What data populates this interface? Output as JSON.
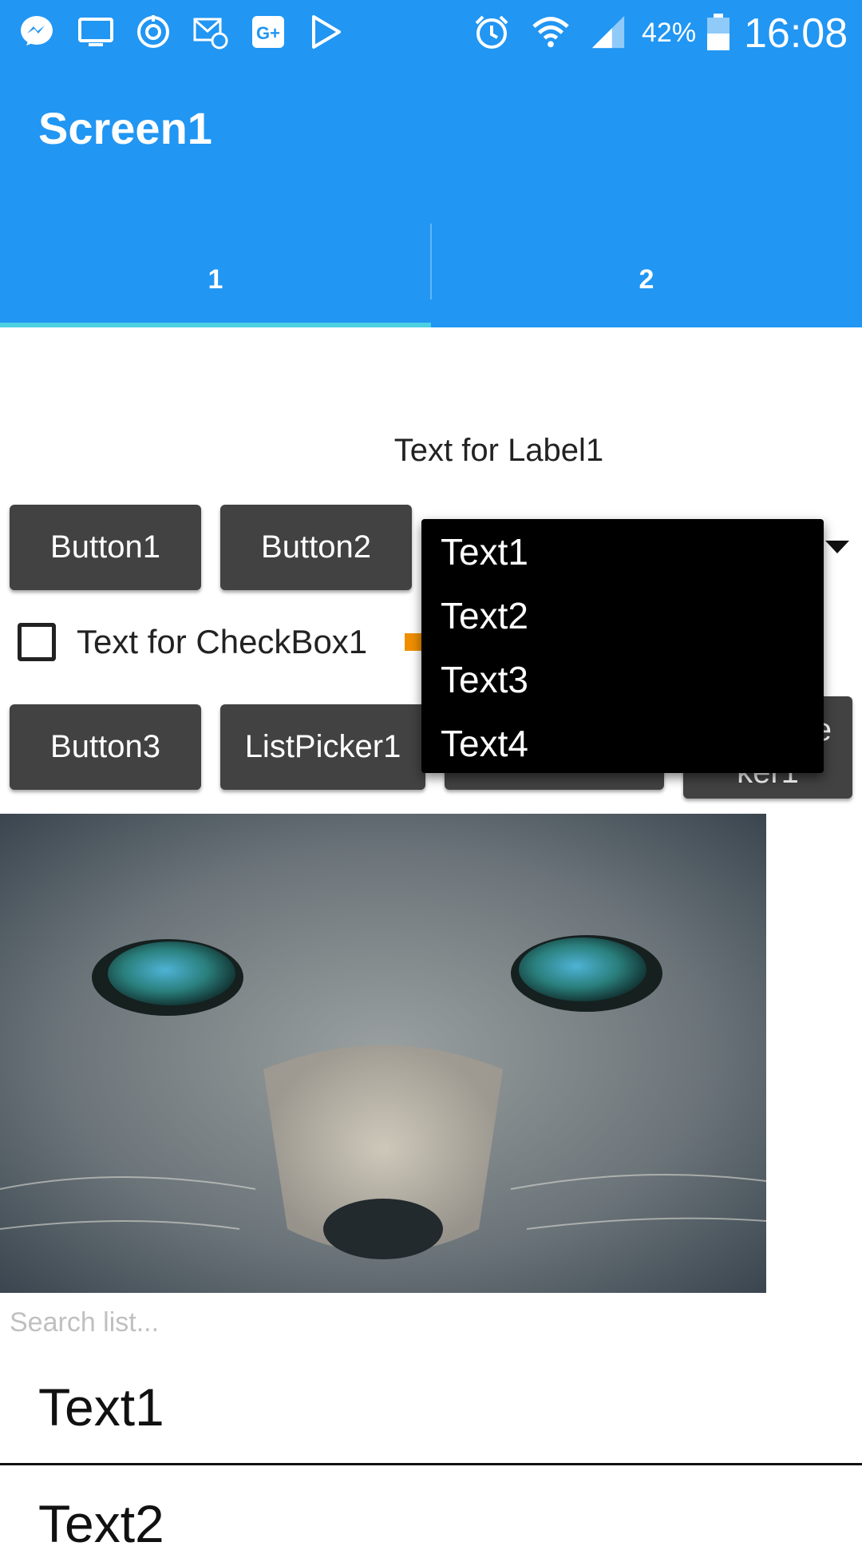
{
  "status_bar": {
    "battery": "42%",
    "time": "16:08",
    "left_icons": [
      "messenger-icon",
      "screen-icon",
      "sync-icon",
      "mail-icon",
      "google-plus-icon",
      "play-store-icon"
    ],
    "right_icons": [
      "alarm-icon",
      "wifi-icon",
      "signal-icon",
      "battery-icon"
    ],
    "color": "#2196f3"
  },
  "app_bar": {
    "title": "Screen1"
  },
  "tabs": [
    {
      "label": "1",
      "selected": true
    },
    {
      "label": "2",
      "selected": false
    }
  ],
  "label1": "Text for Label1",
  "buttons": {
    "button1": "Button1",
    "button2": "Button2",
    "button3": "Button3",
    "listpicker1": "ListPicker1",
    "partial_button_text": "e",
    "partial_picker_text": "ker1"
  },
  "checkbox1": {
    "label": "Text for CheckBox1",
    "checked": false
  },
  "dropdown": {
    "items": [
      "Text1",
      "Text2",
      "Text3",
      "Text4"
    ]
  },
  "image": {
    "subject": "cat-face"
  },
  "search": {
    "placeholder": "Search list..."
  },
  "list": {
    "items": [
      "Text1",
      "Text2"
    ]
  }
}
